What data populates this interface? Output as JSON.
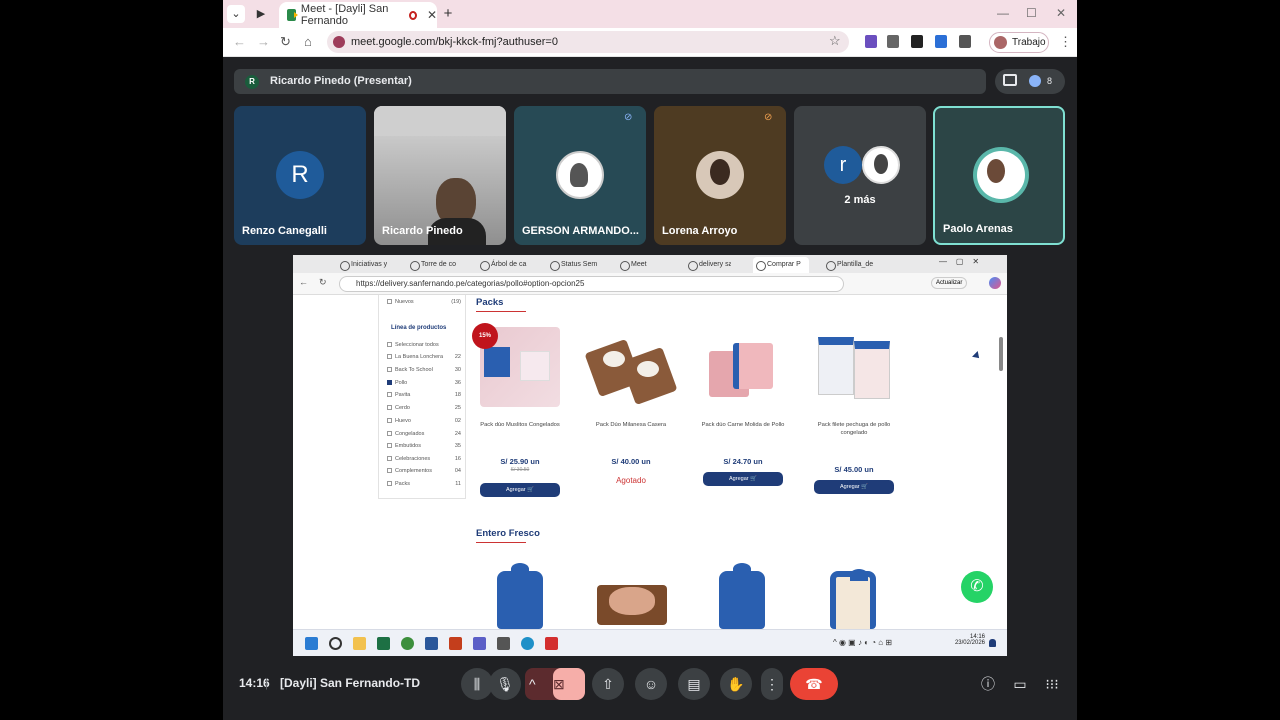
{
  "browser": {
    "tab_title": "Meet - [Dayli] San Fernando",
    "url": "meet.google.com/bkj-kkck-fmj?authuser=0",
    "profile_label": "Trabajo"
  },
  "meet": {
    "presenter_initial": "R",
    "presenter_bar": "Ricardo Pinedo (Presentar)",
    "participant_count": "8",
    "more_label": "2 más",
    "clock": "14:16",
    "meeting_name": "[Dayli] San Fernando-TD",
    "participants": [
      {
        "name": "Renzo Canegalli",
        "initial": "R"
      },
      {
        "name": "Ricardo Pinedo"
      },
      {
        "name": "GERSON ARMANDO..."
      },
      {
        "name": "Lorena Arroyo"
      },
      {
        "initial": "r"
      },
      {
        "name": "Paolo Arenas"
      }
    ]
  },
  "shared": {
    "tabs": [
      "Iniciativas y",
      "Torre de co",
      "Árbol de ca",
      "Status Sem",
      "Meet",
      "delivery sa",
      "Comprar P",
      "Plantilla_de"
    ],
    "url": "https://delivery.sanfernando.pe/categorias/pollo#option-opcion25",
    "update_label": "Actualizar",
    "filter": {
      "top_item": {
        "label": "Nuevos",
        "count": "(19)"
      },
      "title": "Línea de productos",
      "items": [
        {
          "label": "Seleccionar todos",
          "count": ""
        },
        {
          "label": "La Buena Lonchera",
          "count": "22"
        },
        {
          "label": "Back To School",
          "count": "30"
        },
        {
          "label": "Pollo",
          "count": "36"
        },
        {
          "label": "Pavita",
          "count": "18"
        },
        {
          "label": "Cerdo",
          "count": "25"
        },
        {
          "label": "Huevo",
          "count": "02"
        },
        {
          "label": "Congelados",
          "count": "24"
        },
        {
          "label": "Embutidos",
          "count": "35"
        },
        {
          "label": "Celebraciones",
          "count": "16"
        },
        {
          "label": "Complementos",
          "count": "04"
        },
        {
          "label": "Packs",
          "count": "11"
        }
      ]
    },
    "sections": {
      "packs": "Packs",
      "entero": "Entero Fresco"
    },
    "products": [
      {
        "name": "Pack dúo Muslitos Congelados",
        "price": "S/ 25.90 un",
        "old_price": "S/ 30.50",
        "badge": "15%",
        "action": "Agregar"
      },
      {
        "name": "Pack Dúo Milanesa Casera",
        "price": "S/ 40.00 un",
        "status": "Agotado"
      },
      {
        "name": "Pack dúo Carne Molida de Pollo",
        "price": "S/ 24.70 un",
        "action": "Agregar"
      },
      {
        "name": "Pack filete pechuga de pollo congelado",
        "price": "S/ 45.00 un",
        "action": "Agregar"
      }
    ],
    "taskbar": {
      "time": "14:16",
      "date": "23/02/2026"
    }
  }
}
